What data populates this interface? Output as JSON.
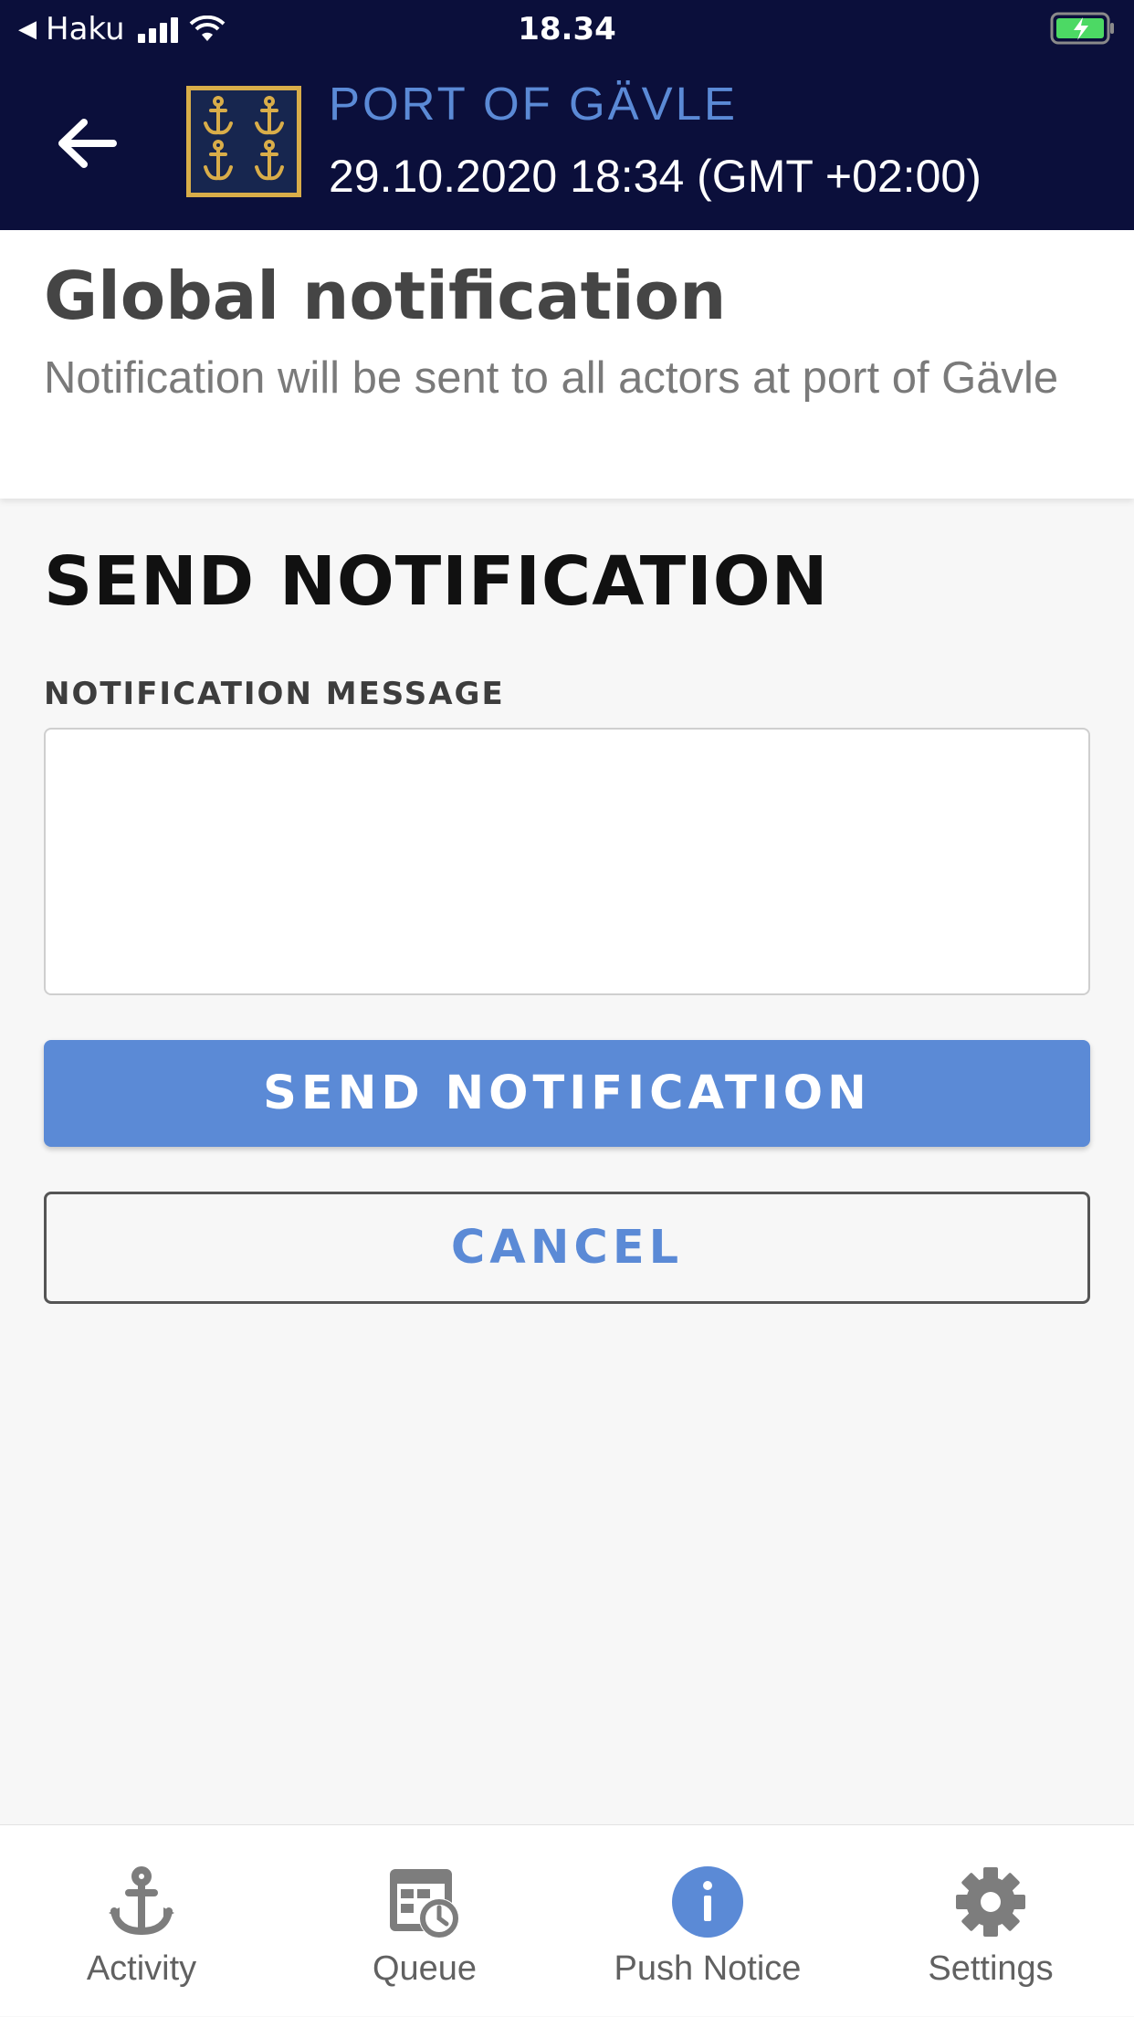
{
  "status_bar": {
    "back_app": "Haku",
    "time": "18.34"
  },
  "header": {
    "port_name": "PORT OF GÄVLE",
    "timestamp": "29.10.2020 18:34 (GMT +02:00)"
  },
  "info": {
    "title": "Global notification",
    "description": "Notification will be sent to all actors at port of Gävle"
  },
  "form": {
    "heading": "SEND NOTIFICATION",
    "message_label": "NOTIFICATION MESSAGE",
    "message_value": "",
    "send_label": "SEND NOTIFICATION",
    "cancel_label": "CANCEL"
  },
  "tabs": [
    {
      "label": "Activity",
      "icon": "anchor-icon",
      "active": false
    },
    {
      "label": "Queue",
      "icon": "queue-clock-icon",
      "active": false
    },
    {
      "label": "Push Notice",
      "icon": "info-icon",
      "active": true
    },
    {
      "label": "Settings",
      "icon": "gear-icon",
      "active": false
    }
  ],
  "colors": {
    "header_bg": "#0b0f3b",
    "accent": "#5b8ad6",
    "logo_gold": "#d9ad49",
    "battery_green": "#4cd964"
  }
}
